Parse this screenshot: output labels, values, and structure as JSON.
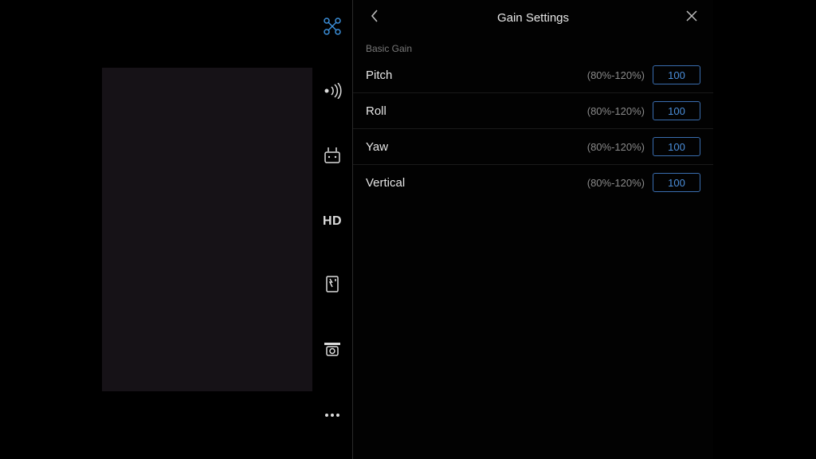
{
  "colors": {
    "accent": "#3b8ed8",
    "value": "#4b8fdc"
  },
  "sidebar": {
    "items": [
      {
        "id": "drone",
        "label": "drone-icon"
      },
      {
        "id": "signal",
        "label": "signal-icon"
      },
      {
        "id": "controller",
        "label": "controller-icon"
      },
      {
        "id": "hd",
        "label": "HD"
      },
      {
        "id": "battery",
        "label": "battery-check-icon"
      },
      {
        "id": "camera",
        "label": "camera-icon"
      },
      {
        "id": "more",
        "label": "more-icon"
      }
    ]
  },
  "panel": {
    "title": "Gain Settings",
    "section_label": "Basic Gain",
    "settings": [
      {
        "label": "Pitch",
        "range": "(80%-120%)",
        "value": "100"
      },
      {
        "label": "Roll",
        "range": "(80%-120%)",
        "value": "100"
      },
      {
        "label": "Yaw",
        "range": "(80%-120%)",
        "value": "100"
      },
      {
        "label": "Vertical",
        "range": "(80%-120%)",
        "value": "100"
      }
    ]
  }
}
